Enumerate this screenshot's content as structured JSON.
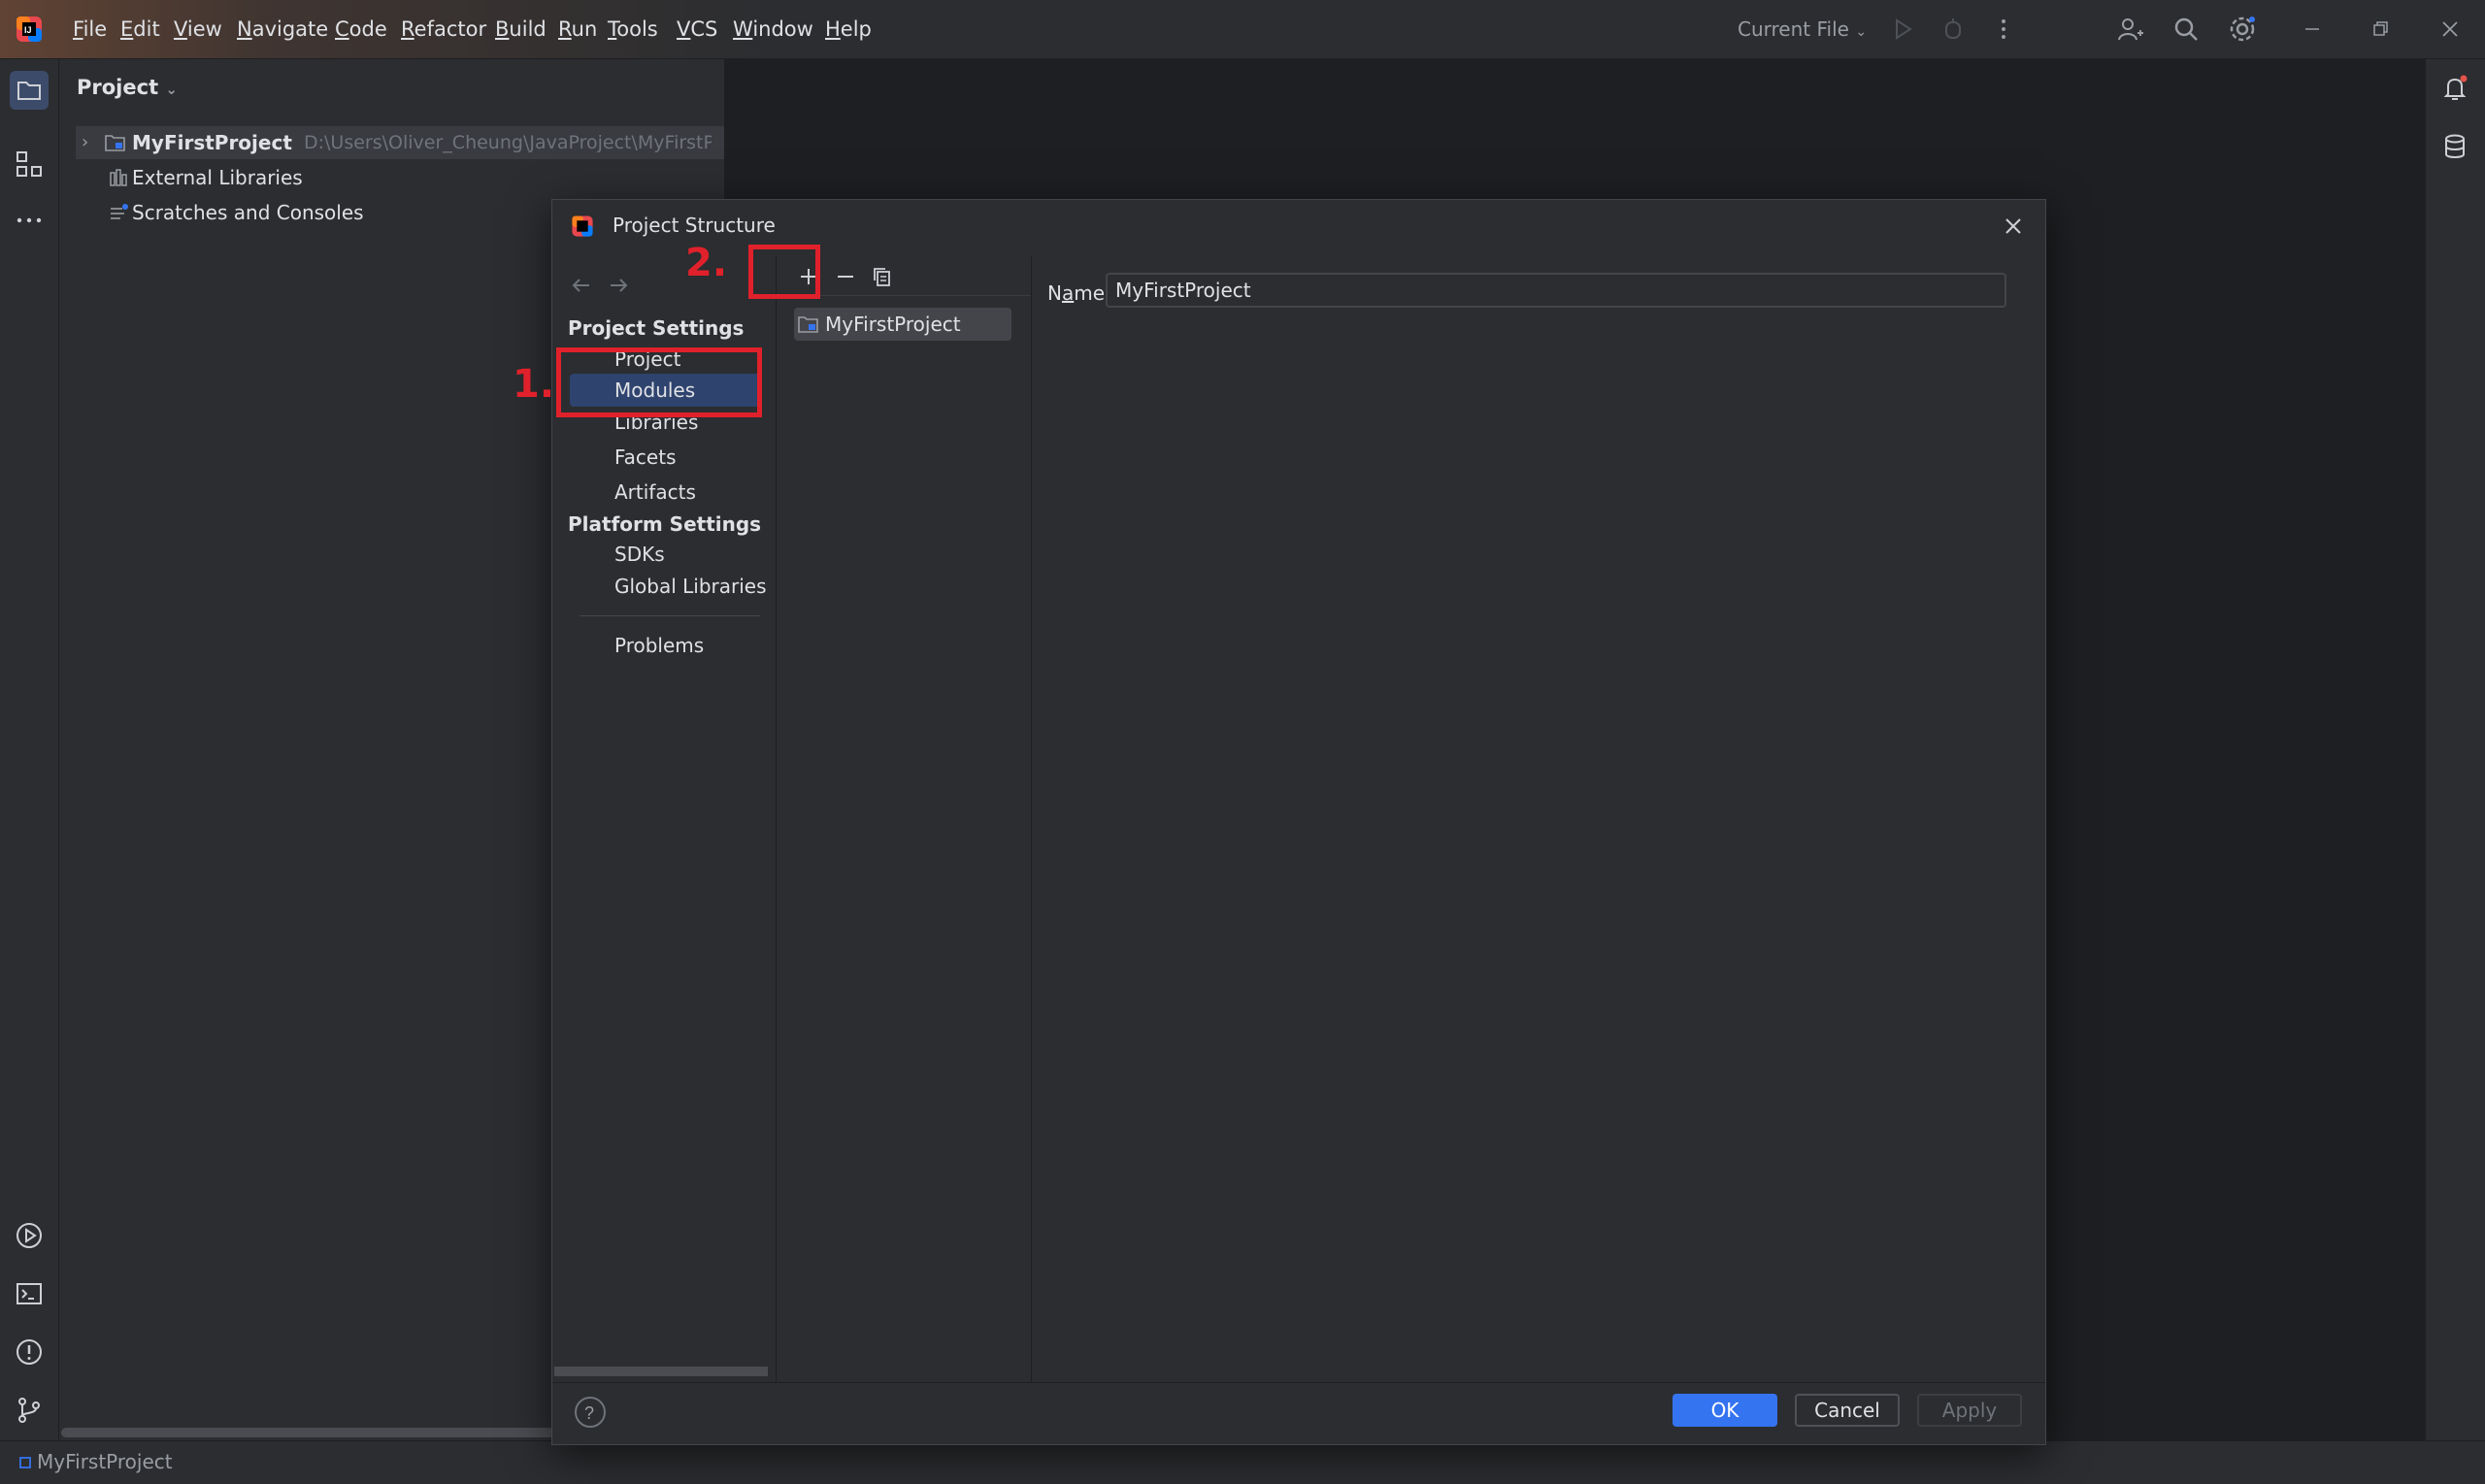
{
  "menu": [
    {
      "label": "File",
      "mn": "F",
      "rest": "ile"
    },
    {
      "label": "Edit",
      "mn": "E",
      "rest": "dit"
    },
    {
      "label": "View",
      "mn": "V",
      "rest": "iew"
    },
    {
      "label": "Navigate",
      "mn": "N",
      "rest": "avigate"
    },
    {
      "label": "Code",
      "mn": "C",
      "rest": "ode"
    },
    {
      "label": "Refactor",
      "mn": "R",
      "rest": "efactor"
    },
    {
      "label": "Build",
      "mn": "B",
      "rest": "uild"
    },
    {
      "label": "Run",
      "mn": "R",
      "rest": "un"
    },
    {
      "label": "Tools",
      "mn": "T",
      "rest": "ools"
    },
    {
      "label": "VCS",
      "mn": "V",
      "rest": "CS"
    },
    {
      "label": "Window",
      "mn": "W",
      "rest": "indow"
    },
    {
      "label": "Help",
      "mn": "H",
      "rest": "elp"
    }
  ],
  "toolbar": {
    "run_config": "Current File"
  },
  "project_panel": {
    "title": "Project",
    "tree": {
      "root_name": "MyFirstProject",
      "root_path": "D:\\Users\\Oliver_Cheung\\JavaProject\\MyFirstProj",
      "external_libraries": "External Libraries",
      "scratches": "Scratches and Consoles"
    }
  },
  "status_bar": {
    "project": "MyFirstProject"
  },
  "dialog": {
    "title": "Project Structure",
    "project_settings_header": "Project Settings",
    "nav_project": "Project",
    "nav_modules": "Modules",
    "nav_libraries": "Libraries",
    "nav_facets": "Facets",
    "nav_artifacts": "Artifacts",
    "platform_settings_header": "Platform Settings",
    "nav_sdks": "SDKs",
    "nav_global_libraries": "Global Libraries",
    "nav_problems": "Problems",
    "module_item": "MyFirstProject",
    "name_label_pre": "N",
    "name_label_mn": "a",
    "name_label_post": "me:",
    "name_value": "MyFirstProject",
    "ok": "OK",
    "cancel": "Cancel",
    "apply": "Apply"
  },
  "annotations": {
    "step1": "1.",
    "step2": "2."
  },
  "colors": {
    "accent": "#3574f0",
    "selection": "#2e436e",
    "annotation": "#e0212b"
  }
}
